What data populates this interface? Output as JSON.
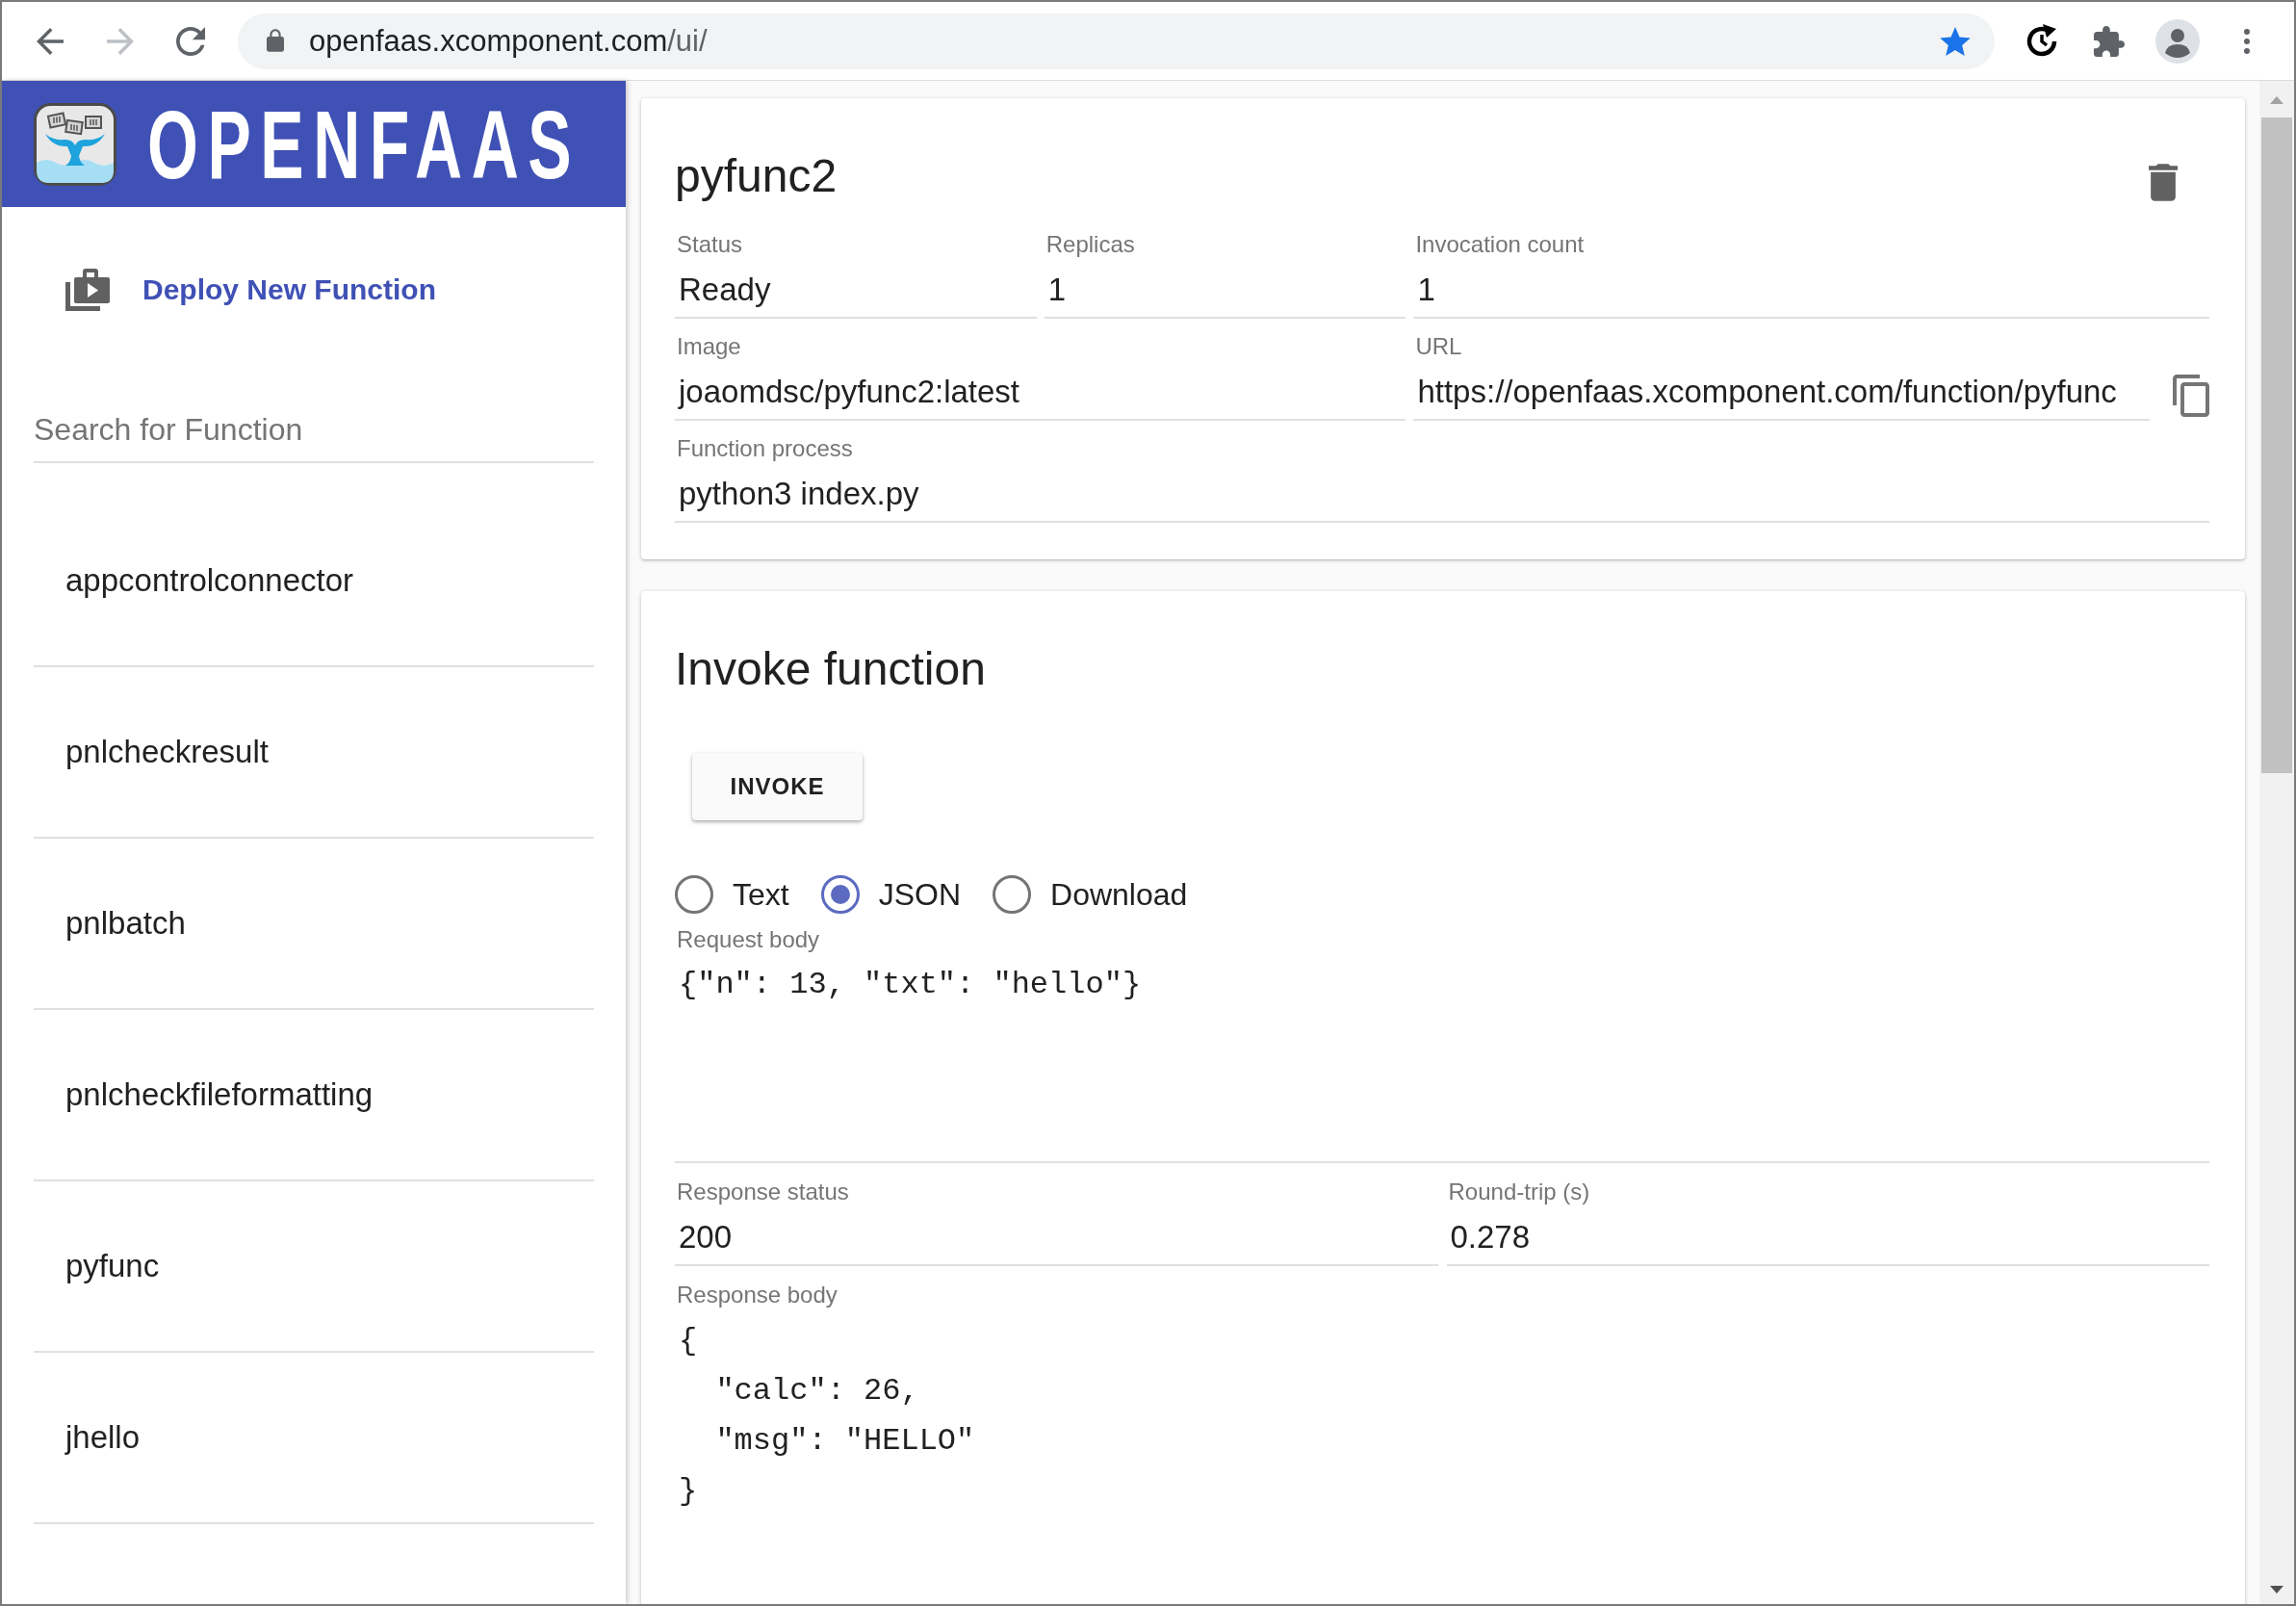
{
  "browser": {
    "url_host": "openfaas.xcomponent.com",
    "url_path": "/ui/",
    "forward_disabled": true,
    "bookmarked": true
  },
  "sidebar": {
    "brand": "OPENFAAS",
    "deploy_label": "Deploy New Function",
    "search": {
      "placeholder": "Search for Function"
    },
    "functions": [
      {
        "name": "appcontrolconnector"
      },
      {
        "name": "pnlcheckresult"
      },
      {
        "name": "pnlbatch"
      },
      {
        "name": "pnlcheckfileformatting"
      },
      {
        "name": "pyfunc"
      },
      {
        "name": "jhello"
      }
    ]
  },
  "function_card": {
    "title": "pyfunc2",
    "fields": [
      {
        "label": "Status",
        "value": "Ready",
        "kind": "text"
      },
      {
        "label": "Replicas",
        "value": "1",
        "kind": "text"
      },
      {
        "label": "Invocation count",
        "value": "1",
        "kind": "text"
      },
      {
        "label": "Image",
        "value": "joaomdsc/pyfunc2:latest",
        "kind": "text"
      },
      {
        "label": "URL",
        "value": "https://openfaas.xcomponent.com/function/pyfunc",
        "kind": "copyable"
      },
      {
        "label": "Function process",
        "value": "python3 index.py",
        "kind": "text"
      }
    ]
  },
  "invoke_card": {
    "title": "Invoke function",
    "button": "INVOKE",
    "formats": [
      {
        "label": "Text",
        "selected": false
      },
      {
        "label": "JSON",
        "selected": true
      },
      {
        "label": "Download",
        "selected": false
      }
    ],
    "request_body": {
      "label": "Request body",
      "value": "{\"n\": 13, \"txt\": \"hello\"}"
    },
    "response_fields": [
      {
        "label": "Response status",
        "value": "200"
      },
      {
        "label": "Round-trip (s)",
        "value": "0.278"
      }
    ],
    "response_body": {
      "label": "Response body",
      "value": "{\n  \"calc\": 26,\n  \"msg\": \"HELLO\"\n}"
    }
  }
}
